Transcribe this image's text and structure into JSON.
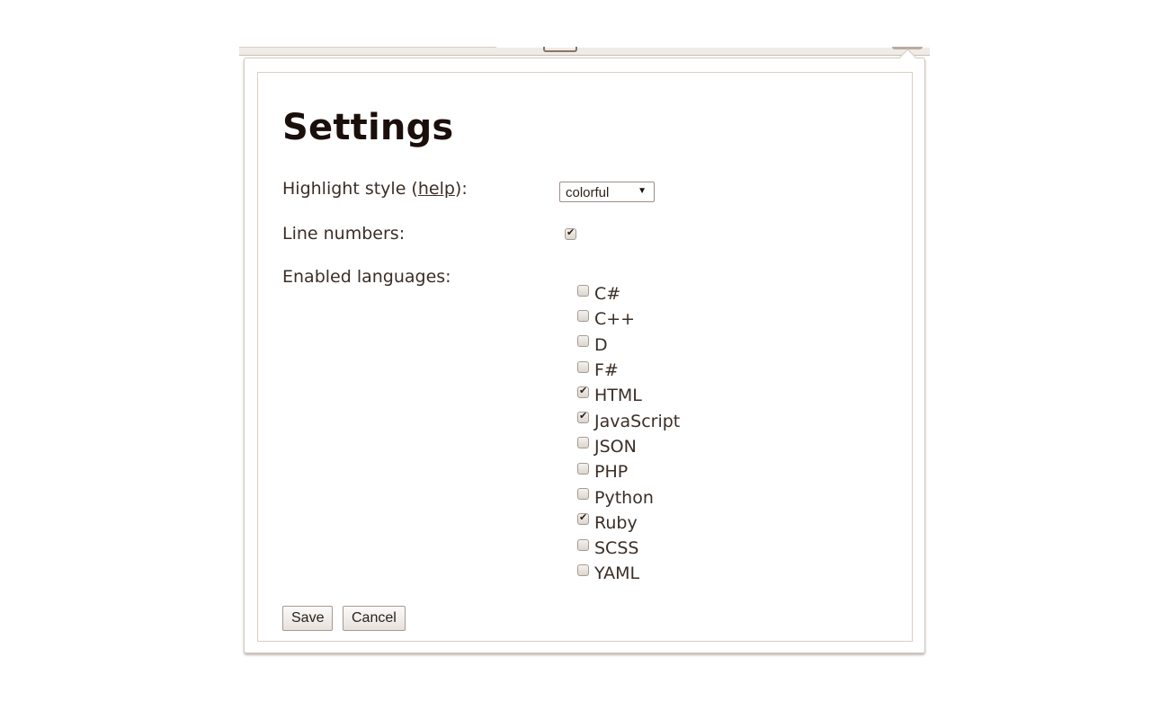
{
  "page_title": "Settings",
  "highlight_style": {
    "label_prefix": "Highlight style (",
    "help_link": "help",
    "label_suffix": "):",
    "selected": "colorful",
    "caret": "▼"
  },
  "line_numbers": {
    "label": "Line numbers:",
    "checked": true
  },
  "enabled_languages": {
    "label": "Enabled languages:",
    "items": [
      {
        "name": "C#",
        "checked": false
      },
      {
        "name": "C++",
        "checked": false
      },
      {
        "name": "D",
        "checked": false
      },
      {
        "name": "F#",
        "checked": false
      },
      {
        "name": "HTML",
        "checked": true
      },
      {
        "name": "JavaScript",
        "checked": true
      },
      {
        "name": "JSON",
        "checked": false
      },
      {
        "name": "PHP",
        "checked": false
      },
      {
        "name": "Python",
        "checked": false
      },
      {
        "name": "Ruby",
        "checked": true
      },
      {
        "name": "SCSS",
        "checked": false
      },
      {
        "name": "YAML",
        "checked": false
      }
    ]
  },
  "buttons": {
    "save": "Save",
    "cancel": "Cancel"
  }
}
